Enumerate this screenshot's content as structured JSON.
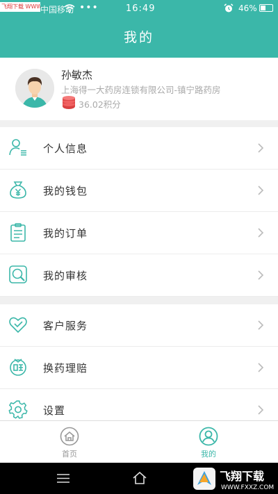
{
  "status_bar": {
    "watermark": "飞翔下载 WWW.FXXZ.COM",
    "carrier": "中国移动",
    "dots": "•••",
    "time": "16:49",
    "battery_percent": "46%",
    "battery_level": 0.46
  },
  "header": {
    "title": "我的"
  },
  "profile": {
    "name": "孙敏杰",
    "company": "上海得一大药房连锁有限公司-镇宁路药房",
    "points": "36.02积分"
  },
  "menu_group_1": [
    {
      "label": "个人信息",
      "icon": "person-icon"
    },
    {
      "label": "我的钱包",
      "icon": "wallet-icon"
    },
    {
      "label": "我的订单",
      "icon": "clipboard-icon"
    },
    {
      "label": "我的审核",
      "icon": "review-search-icon"
    }
  ],
  "menu_group_2": [
    {
      "label": "客户服务",
      "icon": "heart-icon"
    },
    {
      "label": "换药理赔",
      "icon": "claim-icon"
    },
    {
      "label": "设置",
      "icon": "gear-icon"
    }
  ],
  "tabs": [
    {
      "label": "首页",
      "icon": "home-icon",
      "active": false
    },
    {
      "label": "我的",
      "icon": "user-icon",
      "active": true
    }
  ],
  "bottom_watermark": {
    "title": "飞翔下载",
    "url": "WWW.FXXZ.COM"
  },
  "colors": {
    "accent": "#3bb7a9",
    "coin": "#e04848",
    "text": "#333333",
    "muted": "#aaaaaa"
  }
}
